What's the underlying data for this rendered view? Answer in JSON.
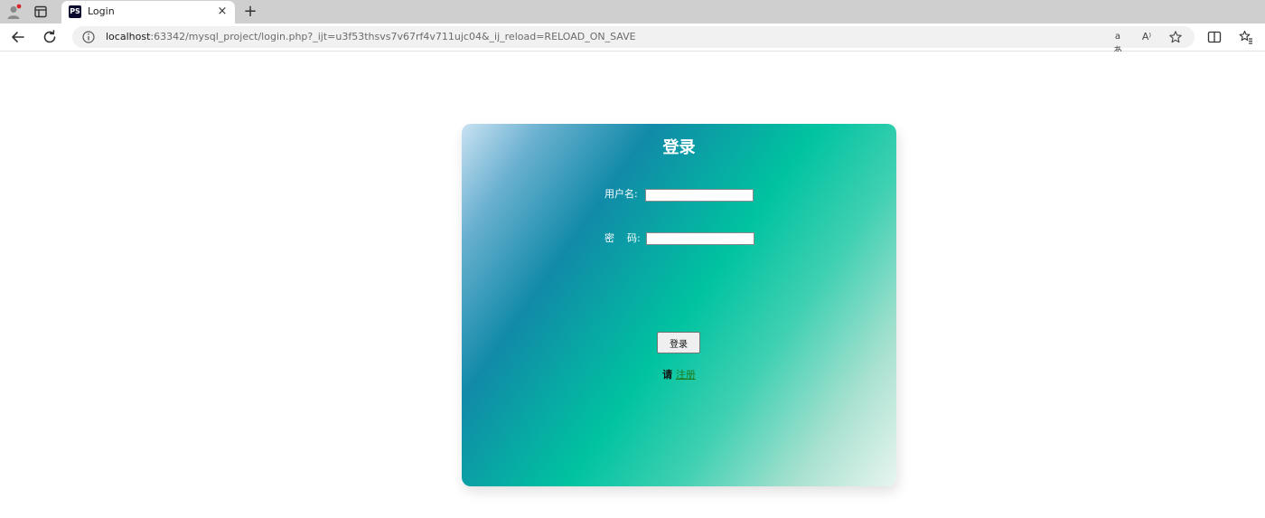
{
  "browser": {
    "tab": {
      "favicon_text": "PS",
      "title": "Login",
      "close_glyph": "×"
    },
    "new_tab_glyph": "+",
    "address": {
      "host": "localhost",
      "rest": ":63342/mysql_project/login.php?_ijt=u3f53thsvs7v67rf4v711ujc04&_ij_reload=RELOAD_ON_SAVE"
    },
    "toolbar_icons": [
      "translate-icon",
      "read-aloud-icon",
      "favorite-star-icon",
      "split-screen-icon",
      "favorites-icon"
    ],
    "read_aloud_glyph": "A⁾",
    "translate_glyph": "aあ"
  },
  "login": {
    "title": "登录",
    "username_label": "用户名:",
    "password_label": "密    码:",
    "username_value": "",
    "password_value": "",
    "submit_label": "登录",
    "register_prefix": "请 ",
    "register_link": "注册"
  },
  "colors": {
    "card_gradient": [
      "#c9e2f2",
      "#118aa8",
      "#00c3a0",
      "#e8f5f0"
    ],
    "register_link": "#1e7b1e"
  }
}
